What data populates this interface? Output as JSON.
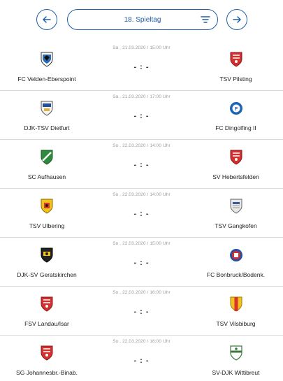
{
  "header": {
    "matchday_label": "18. Spieltag"
  },
  "matches": [
    {
      "datetime": "Sa , 21.03.2020 / 15:00 Uhr",
      "score": "- : -",
      "home": {
        "name": "FC Velden-Eberspoint",
        "crest": "eagle-crest-icon"
      },
      "away": {
        "name": "TSV Pilsting",
        "crest": "red-crest-icon"
      }
    },
    {
      "datetime": "Sa , 21.03.2020 / 17:00 Uhr",
      "score": "- : -",
      "home": {
        "name": "DJK-TSV Dietfurt",
        "crest": "blue-crest-icon"
      },
      "away": {
        "name": "FC Dingolfing II",
        "crest": "blue-circle-crest-icon"
      }
    },
    {
      "datetime": "So , 22.03.2020 / 14:00 Uhr",
      "score": "- : -",
      "home": {
        "name": "SC Aufhausen",
        "crest": "green-crest-icon"
      },
      "away": {
        "name": "SV Hebertsfelden",
        "crest": "red-crest-icon"
      }
    },
    {
      "datetime": "So , 22.03.2020 / 14:00 Uhr",
      "score": "- : -",
      "home": {
        "name": "TSV Ulbering",
        "crest": "yellow-red-crest-icon"
      },
      "away": {
        "name": "TSV Gangkofen",
        "crest": "grey-crest-icon"
      }
    },
    {
      "datetime": "So , 22.03.2020 / 15:00 Uhr",
      "score": "- : -",
      "home": {
        "name": "DJK-SV Geratskirchen",
        "crest": "black-yellow-crest-icon"
      },
      "away": {
        "name": "FC Bonbruck/Bodenk.",
        "crest": "red-blue-crest-icon"
      }
    },
    {
      "datetime": "So , 22.03.2020 / 16:00 Uhr",
      "score": "- : -",
      "home": {
        "name": "FSV Landau/Isar",
        "crest": "red-crest-icon"
      },
      "away": {
        "name": "TSV Vilsbiburg",
        "crest": "red-yellow-crest-icon"
      }
    },
    {
      "datetime": "So , 22.03.2020 / 16:00 Uhr",
      "score": "- : -",
      "home": {
        "name": "SG Johannesbr.-Binab.",
        "crest": "red-crest-icon"
      },
      "away": {
        "name": "SV-DJK Wittibreut",
        "crest": "green-white-crest-icon"
      }
    }
  ],
  "colors": {
    "accent": "#1f5ea8",
    "divider": "#d9d9d9",
    "date_text": "#9a9a9a"
  }
}
